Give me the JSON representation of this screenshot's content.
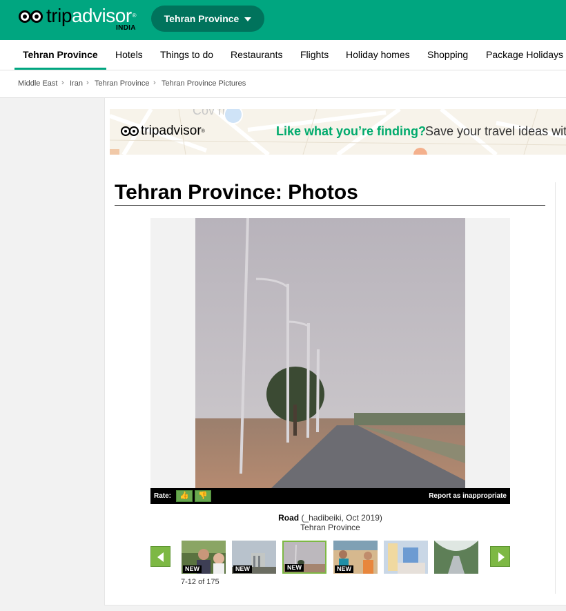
{
  "header": {
    "logo_text_trip": "trip",
    "logo_text_advisor": "advisor",
    "logo_sub": "INDIA",
    "geo_button_label": "Tehran Province"
  },
  "nav": {
    "items": [
      {
        "label": "Tehran Province",
        "active": true
      },
      {
        "label": "Hotels"
      },
      {
        "label": "Things to do"
      },
      {
        "label": "Restaurants"
      },
      {
        "label": "Flights"
      },
      {
        "label": "Holiday homes"
      },
      {
        "label": "Shopping"
      },
      {
        "label": "Package Holidays"
      }
    ]
  },
  "breadcrumb": [
    "Middle East",
    "Iran",
    "Tehran Province",
    "Tehran Province Pictures"
  ],
  "ad": {
    "logo_text": "tripadvisor",
    "headline": "Like what you’re finding?",
    "tagline": "Save your travel ideas wit"
  },
  "page_title": "Tehran Province: Photos",
  "viewer": {
    "rate_label": "Rate:",
    "thumbs_up": "👍",
    "thumbs_down": "👎",
    "report_label": "Report as inappropriate"
  },
  "caption": {
    "photo_title": "Road",
    "photo_meta": "(_hadibeiki, Oct 2019)",
    "location": "Tehran Province"
  },
  "thumbnails": {
    "counter": "7-12 of 175",
    "new_label": "NEW",
    "items": [
      {
        "new": true
      },
      {
        "new": true
      },
      {
        "new": true,
        "selected": true
      },
      {
        "new": true
      },
      {
        "new": false
      },
      {
        "new": false
      }
    ]
  },
  "colors": {
    "brand_green": "#00a680",
    "geo_button": "#00735c",
    "nav_active_underline": "#00a680",
    "ad_headline": "#00aa6c",
    "arrow_green": "#7db844"
  }
}
